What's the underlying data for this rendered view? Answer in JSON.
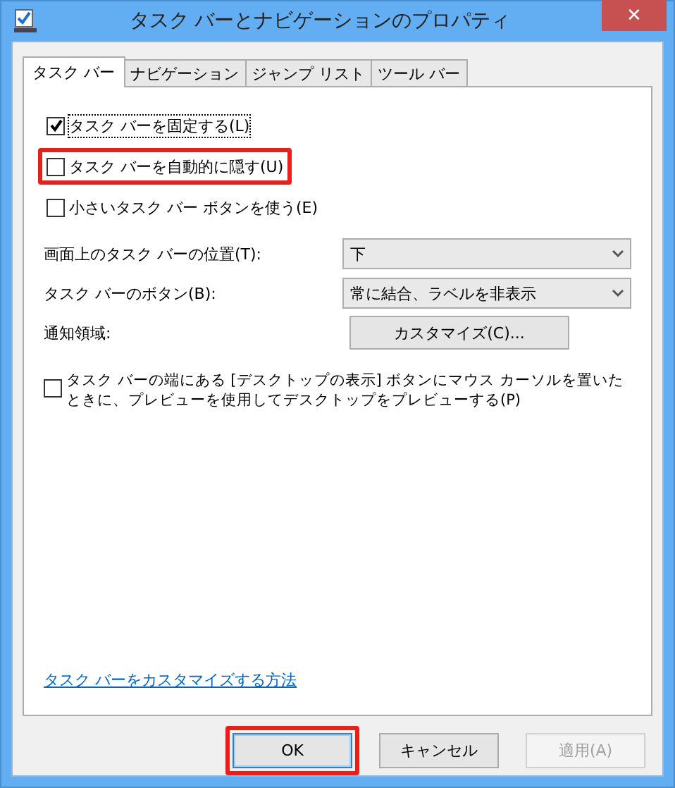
{
  "window": {
    "title": "タスク バーとナビゲーションのプロパティ",
    "close": "✕"
  },
  "tabs": [
    {
      "label": "タスク バー",
      "selected": true
    },
    {
      "label": "ナビゲーション",
      "selected": false
    },
    {
      "label": "ジャンプ リスト",
      "selected": false
    },
    {
      "label": "ツール バー",
      "selected": false
    }
  ],
  "options": [
    {
      "label": "タスク バーを固定する(L)",
      "checked": true,
      "highlighted": false,
      "focused": true
    },
    {
      "label": "タスク バーを自動的に隠す(U)",
      "checked": false,
      "highlighted": true,
      "focused": false
    },
    {
      "label": "小さいタスク バー ボタンを使う(E)",
      "checked": false,
      "highlighted": false,
      "focused": false
    }
  ],
  "settings": [
    {
      "kind": "dropdown",
      "label": "画面上のタスク バーの位置(T):",
      "value": "下"
    },
    {
      "kind": "dropdown",
      "label": "タスク バーのボタン(B):",
      "value": "常に結合、ラベルを非表示"
    },
    {
      "kind": "button",
      "label": "通知領域:",
      "value": "カスタマイズ(C)..."
    }
  ],
  "peek_option": {
    "label": "タスク バーの端にある [デスクトップの表示] ボタンにマウス カーソルを置いたときに、プレビューを使用してデスクトップをプレビューする(P)",
    "checked": false
  },
  "help_link": "タスク バーをカスタマイズする方法",
  "buttons": [
    {
      "label": "OK",
      "disabled": false,
      "highlighted": true,
      "default": true
    },
    {
      "label": "キャンセル",
      "disabled": false,
      "highlighted": false,
      "default": false
    },
    {
      "label": "適用(A)",
      "disabled": true,
      "highlighted": false,
      "default": false
    }
  ]
}
